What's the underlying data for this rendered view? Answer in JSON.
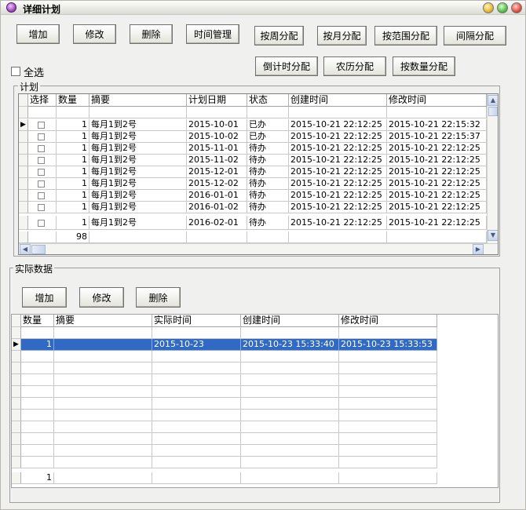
{
  "window": {
    "title": "详细计划"
  },
  "toolbar": {
    "row1": [
      "增加",
      "修改",
      "删除",
      "时间管理",
      "按周分配",
      "按月分配",
      "按范围分配",
      "间隔分配"
    ],
    "row2": [
      "倒计时分配",
      "农历分配",
      "按数量分配"
    ]
  },
  "select_all": {
    "label": "全选"
  },
  "plan": {
    "legend": "计划",
    "columns": [
      "选择",
      "数量",
      "摘要",
      "计划日期",
      "状态",
      "创建时间",
      "修改时间"
    ],
    "rows": [
      {
        "qty": "1",
        "summary": "每月1到2号",
        "date": "2015-10-01",
        "status": "已办",
        "created": "2015-10-21 22:12:25",
        "modified": "2015-10-21 22:15:32"
      },
      {
        "qty": "1",
        "summary": "每月1到2号",
        "date": "2015-10-02",
        "status": "已办",
        "created": "2015-10-21 22:12:25",
        "modified": "2015-10-21 22:15:37"
      },
      {
        "qty": "1",
        "summary": "每月1到2号",
        "date": "2015-11-01",
        "status": "待办",
        "created": "2015-10-21 22:12:25",
        "modified": "2015-10-21 22:12:25"
      },
      {
        "qty": "1",
        "summary": "每月1到2号",
        "date": "2015-11-02",
        "status": "待办",
        "created": "2015-10-21 22:12:25",
        "modified": "2015-10-21 22:12:25"
      },
      {
        "qty": "1",
        "summary": "每月1到2号",
        "date": "2015-12-01",
        "status": "待办",
        "created": "2015-10-21 22:12:25",
        "modified": "2015-10-21 22:12:25"
      },
      {
        "qty": "1",
        "summary": "每月1到2号",
        "date": "2015-12-02",
        "status": "待办",
        "created": "2015-10-21 22:12:25",
        "modified": "2015-10-21 22:12:25"
      },
      {
        "qty": "1",
        "summary": "每月1到2号",
        "date": "2016-01-01",
        "status": "待办",
        "created": "2015-10-21 22:12:25",
        "modified": "2015-10-21 22:12:25"
      },
      {
        "qty": "1",
        "summary": "每月1到2号",
        "date": "2016-01-02",
        "status": "待办",
        "created": "2015-10-21 22:12:25",
        "modified": "2015-10-21 22:12:25"
      },
      {
        "qty": "1",
        "summary": "每月1到2号",
        "date": "2016-02-01",
        "status": "待办",
        "created": "2015-10-21 22:12:25",
        "modified": "2015-10-21 22:12:25"
      }
    ],
    "total_qty": "98"
  },
  "actual": {
    "legend": "实际数据",
    "buttons": [
      "增加",
      "修改",
      "删除"
    ],
    "columns": [
      "数量",
      "摘要",
      "实际时间",
      "创建时间",
      "修改时间"
    ],
    "rows": [
      {
        "qty": "1",
        "summary": "",
        "actual": "2015-10-23",
        "created": "2015-10-23 15:33:40",
        "modified": "2015-10-23 15:33:53"
      }
    ],
    "total_qty": "1"
  },
  "colors": {
    "selection": "#316ac5",
    "window_bg": "#f0f0ef"
  }
}
